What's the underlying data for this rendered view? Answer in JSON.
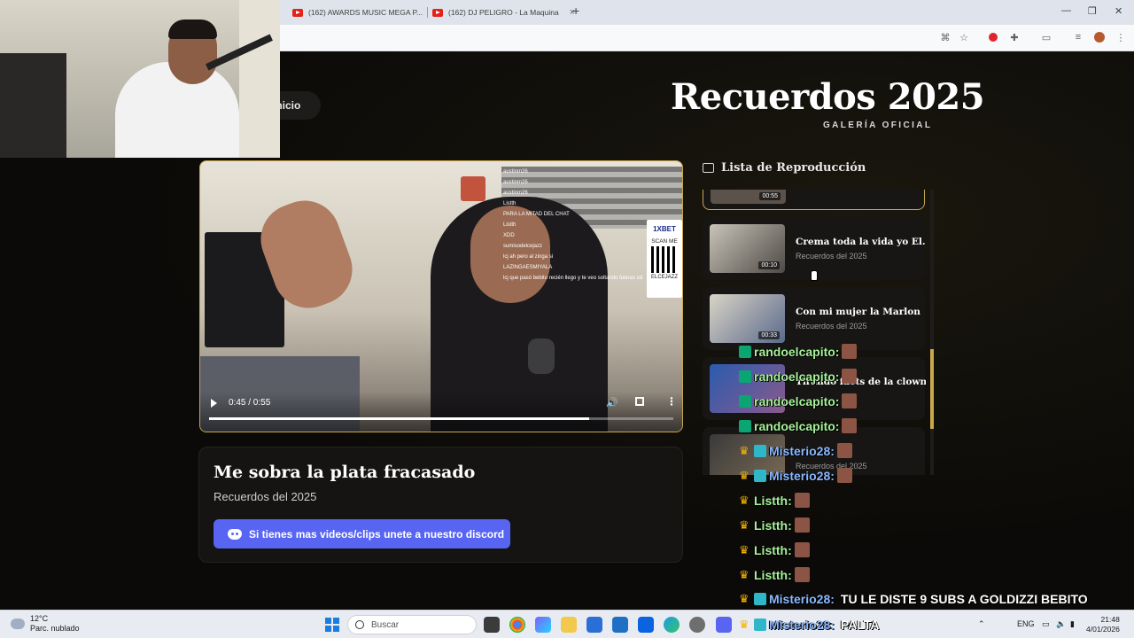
{
  "browser": {
    "tabs": [
      {
        "label": "(162) AWARDS MUSIC MEGA P..."
      },
      {
        "label": "(162) DJ PELIGRO - La Maquina"
      }
    ],
    "new_tab": "+",
    "win_min": "—",
    "win_max": "❐",
    "win_close": "✕"
  },
  "nav": {
    "inicio": "Inicio"
  },
  "header": {
    "title": "Recuerdos 2025",
    "subtitle": "GALERÍA OFICIAL"
  },
  "video": {
    "time": "0:45 / 0:55",
    "progress": 0.818,
    "overlay_chat": [
      "austinm26",
      "austinm26",
      "austinm26",
      "Listth",
      "PARA LA MITAD DEL CHAT",
      "Listth",
      "XDD",
      "sumisodelcejazz",
      "lcj ah pero al zinga si",
      "LAZINGAESMIYALA",
      "lcj que pasó bebito recién llego y te veo soltando fuleras xd"
    ],
    "sponsor": {
      "brand": "1XBET",
      "scan": "SCAN ME",
      "handle": "ELCEJAZZ"
    }
  },
  "now_playing": {
    "title": "Me sobra la plata fracasado",
    "subtitle": "Recuerdos del 2025",
    "discord_button": "Si tienes mas videos/clips unete a nuestro discord"
  },
  "playlist": {
    "heading": "Lista de Reproducción",
    "items": [
      {
        "title": "",
        "subtitle": "",
        "duration": "00:55"
      },
      {
        "title": "Crema toda la vida yo El...",
        "subtitle": "Recuerdos del 2025",
        "duration": "00:10"
      },
      {
        "title": "Con mi mujer la Marlon",
        "subtitle": "Recuerdos del 2025",
        "duration": "00:33"
      },
      {
        "title": "Tirando facts de la clown",
        "subtitle": "Recuerdos del 2025",
        "duration": ""
      },
      {
        "title": "",
        "subtitle": "Recuerdos del 2025",
        "duration": ""
      }
    ]
  },
  "stream_chat": [
    {
      "name": "randoelcapito:",
      "msg": ""
    },
    {
      "name": "randoelcapito:",
      "msg": ""
    },
    {
      "name": "randoelcapito:",
      "msg": ""
    },
    {
      "name": "randoelcapito:",
      "msg": ""
    },
    {
      "name": "Misterio28:",
      "msg": ""
    },
    {
      "name": "Misterio28:",
      "msg": ""
    },
    {
      "name": "Listth:",
      "msg": ""
    },
    {
      "name": "Listth:",
      "msg": ""
    },
    {
      "name": "Listth:",
      "msg": ""
    },
    {
      "name": "Listth:",
      "msg": ""
    },
    {
      "name": "Misterio28:",
      "msg": "TU LE DISTE 9 SUBS A GOLDIZZI BEBITO"
    },
    {
      "name": "Misterio28:",
      "msg": "PALTA"
    }
  ],
  "taskbar": {
    "weather_temp": "12°C",
    "weather_desc": "Parc. nublado",
    "search_placeholder": "Buscar",
    "lang": "ENG",
    "time": "21:48",
    "date": "4/01/2026"
  },
  "colors": {
    "accent_gold": "#c9a84a",
    "discord": "#5865f2",
    "background": "#0b0a08"
  }
}
